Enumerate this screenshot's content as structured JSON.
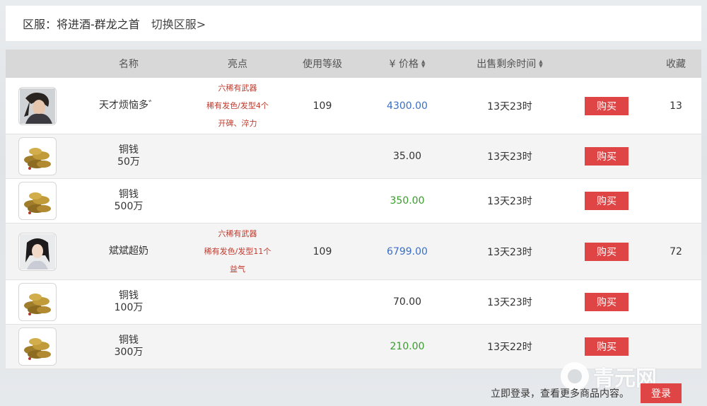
{
  "server": {
    "label": "区服：将进酒-群龙之首",
    "switch_label": "切换区服>"
  },
  "columns": {
    "name": "名称",
    "highlight": "亮点",
    "level": "使用等级",
    "price": "¥ 价格",
    "time": "出售剩余时间",
    "favorite": "收藏"
  },
  "rows": [
    {
      "type": "character",
      "name": "天才烦恼多゛",
      "name2": "",
      "highlights": [
        "六稀有武器",
        "稀有发色/发型4个",
        "开碑、淬力"
      ],
      "level": "109",
      "price": "4300.00",
      "price_color": "blue",
      "time": "13天23时",
      "buy": "购买",
      "favorites": "13"
    },
    {
      "type": "coin",
      "name": "铜钱",
      "name2": "50万",
      "highlights": [],
      "level": "",
      "price": "35.00",
      "price_color": "plain",
      "time": "13天23时",
      "buy": "购买",
      "favorites": ""
    },
    {
      "type": "coin",
      "name": "铜钱",
      "name2": "500万",
      "highlights": [],
      "level": "",
      "price": "350.00",
      "price_color": "green",
      "time": "13天23时",
      "buy": "购买",
      "favorites": ""
    },
    {
      "type": "character2",
      "name": "斌斌超奶",
      "name2": "",
      "highlights": [
        "六稀有武器",
        "稀有发色/发型11个",
        "益气"
      ],
      "level": "109",
      "price": "6799.00",
      "price_color": "blue",
      "time": "13天23时",
      "buy": "购买",
      "favorites": "72"
    },
    {
      "type": "coin",
      "name": "铜钱",
      "name2": "100万",
      "highlights": [],
      "level": "",
      "price": "70.00",
      "price_color": "plain",
      "time": "13天23时",
      "buy": "购买",
      "favorites": ""
    },
    {
      "type": "coin",
      "name": "铜钱",
      "name2": "300万",
      "highlights": [],
      "level": "",
      "price": "210.00",
      "price_color": "green",
      "time": "13天22时",
      "buy": "购买",
      "favorites": ""
    }
  ],
  "footer": {
    "text": "立即登录，查看更多商品内容。",
    "login": "登录"
  },
  "watermark": "青元网",
  "colors": {
    "accent_red": "#e04545",
    "price_blue": "#3b6fc4",
    "price_green": "#3a9b2e",
    "highlight_red": "#c0392b"
  }
}
